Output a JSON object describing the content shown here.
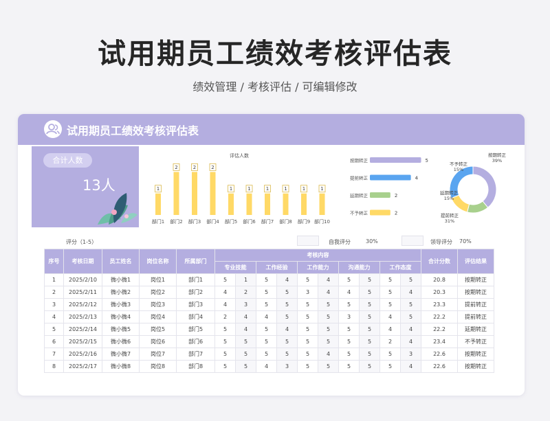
{
  "header": {
    "title": "试用期员工绩效考核评估表",
    "subtitle": "绩效管理 / 考核评估 /  可编辑修改"
  },
  "card": {
    "title": "试用期员工绩效考核评估表",
    "icon": "users-icon",
    "accent_color": "#b4aee0"
  },
  "summary": {
    "label": "合计人数",
    "value": "13人"
  },
  "chart_data": [
    {
      "type": "bar",
      "title": "评估人数",
      "categories": [
        "部门1",
        "部门2",
        "部门3",
        "部门4",
        "部门5",
        "部门6",
        "部门7",
        "部门8",
        "部门9",
        "部门10"
      ],
      "values": [
        1,
        2,
        2,
        2,
        1,
        1,
        1,
        1,
        1,
        1
      ],
      "ylim": [
        0,
        2.3
      ],
      "bar_color": "#ffd966",
      "data_labels": true,
      "grid": false
    },
    {
      "type": "bar",
      "orientation": "horizontal",
      "categories": [
        "按期转正",
        "提前转正",
        "延期转正",
        "不予转正"
      ],
      "values": [
        5,
        4,
        2,
        2
      ],
      "colors": [
        "#b4aee0",
        "#5aa5f0",
        "#a8d08d",
        "#ffd966"
      ],
      "xlim": [
        0,
        5.5
      ],
      "data_labels": true
    },
    {
      "type": "pie",
      "style": "donut",
      "labels": [
        "按期转正",
        "延期转正",
        "不予转正",
        "提前转正"
      ],
      "values": [
        39,
        15,
        15,
        31
      ],
      "display_values": [
        "39%",
        "15%",
        "15%",
        "31%"
      ],
      "colors": [
        "#b4aee0",
        "#a8d08d",
        "#ffd966",
        "#5aa5f0"
      ]
    }
  ],
  "scoring": {
    "label": "评分（1-5）",
    "self_label": "自我评分",
    "self_value": "30%",
    "leader_label": "领导评分",
    "leader_value": "70%"
  },
  "table": {
    "columns": [
      "序号",
      "考核日期",
      "员工姓名",
      "岗位名称",
      "所属部门",
      "考核内容",
      "合计分数",
      "评估结果"
    ],
    "group_label": "考核内容",
    "sub_columns": [
      "专业技能",
      "工作经验",
      "工作能力",
      "沟通能力",
      "工作态度"
    ],
    "rows": [
      [
        "1",
        "2025/2/10",
        "微小微1",
        "岗位1",
        "部门1",
        "5",
        "1",
        "5",
        "4",
        "5",
        "4",
        "5",
        "5",
        "5",
        "5",
        "20.8",
        "按期转正"
      ],
      [
        "2",
        "2025/2/11",
        "微小微2",
        "岗位2",
        "部门2",
        "4",
        "2",
        "5",
        "5",
        "3",
        "4",
        "4",
        "5",
        "5",
        "4",
        "20.3",
        "按期转正"
      ],
      [
        "3",
        "2025/2/12",
        "微小微3",
        "岗位3",
        "部门3",
        "4",
        "3",
        "5",
        "5",
        "5",
        "5",
        "5",
        "5",
        "5",
        "5",
        "23.3",
        "提前转正"
      ],
      [
        "4",
        "2025/2/13",
        "微小微4",
        "岗位4",
        "部门4",
        "2",
        "4",
        "4",
        "5",
        "5",
        "5",
        "3",
        "5",
        "4",
        "5",
        "22.2",
        "提前转正"
      ],
      [
        "5",
        "2025/2/14",
        "微小微5",
        "岗位5",
        "部门5",
        "5",
        "4",
        "5",
        "4",
        "5",
        "5",
        "5",
        "5",
        "4",
        "4",
        "22.2",
        "延期转正"
      ],
      [
        "6",
        "2025/2/15",
        "微小微6",
        "岗位6",
        "部门6",
        "5",
        "5",
        "5",
        "5",
        "5",
        "5",
        "5",
        "5",
        "2",
        "4",
        "23.4",
        "不予转正"
      ],
      [
        "7",
        "2025/2/16",
        "微小微7",
        "岗位7",
        "部门7",
        "5",
        "5",
        "5",
        "5",
        "5",
        "4",
        "5",
        "5",
        "5",
        "3",
        "22.6",
        "按期转正"
      ],
      [
        "8",
        "2025/2/17",
        "微小微8",
        "岗位8",
        "部门8",
        "5",
        "5",
        "4",
        "3",
        "5",
        "5",
        "5",
        "5",
        "5",
        "4",
        "22.6",
        "按期转正"
      ]
    ]
  }
}
